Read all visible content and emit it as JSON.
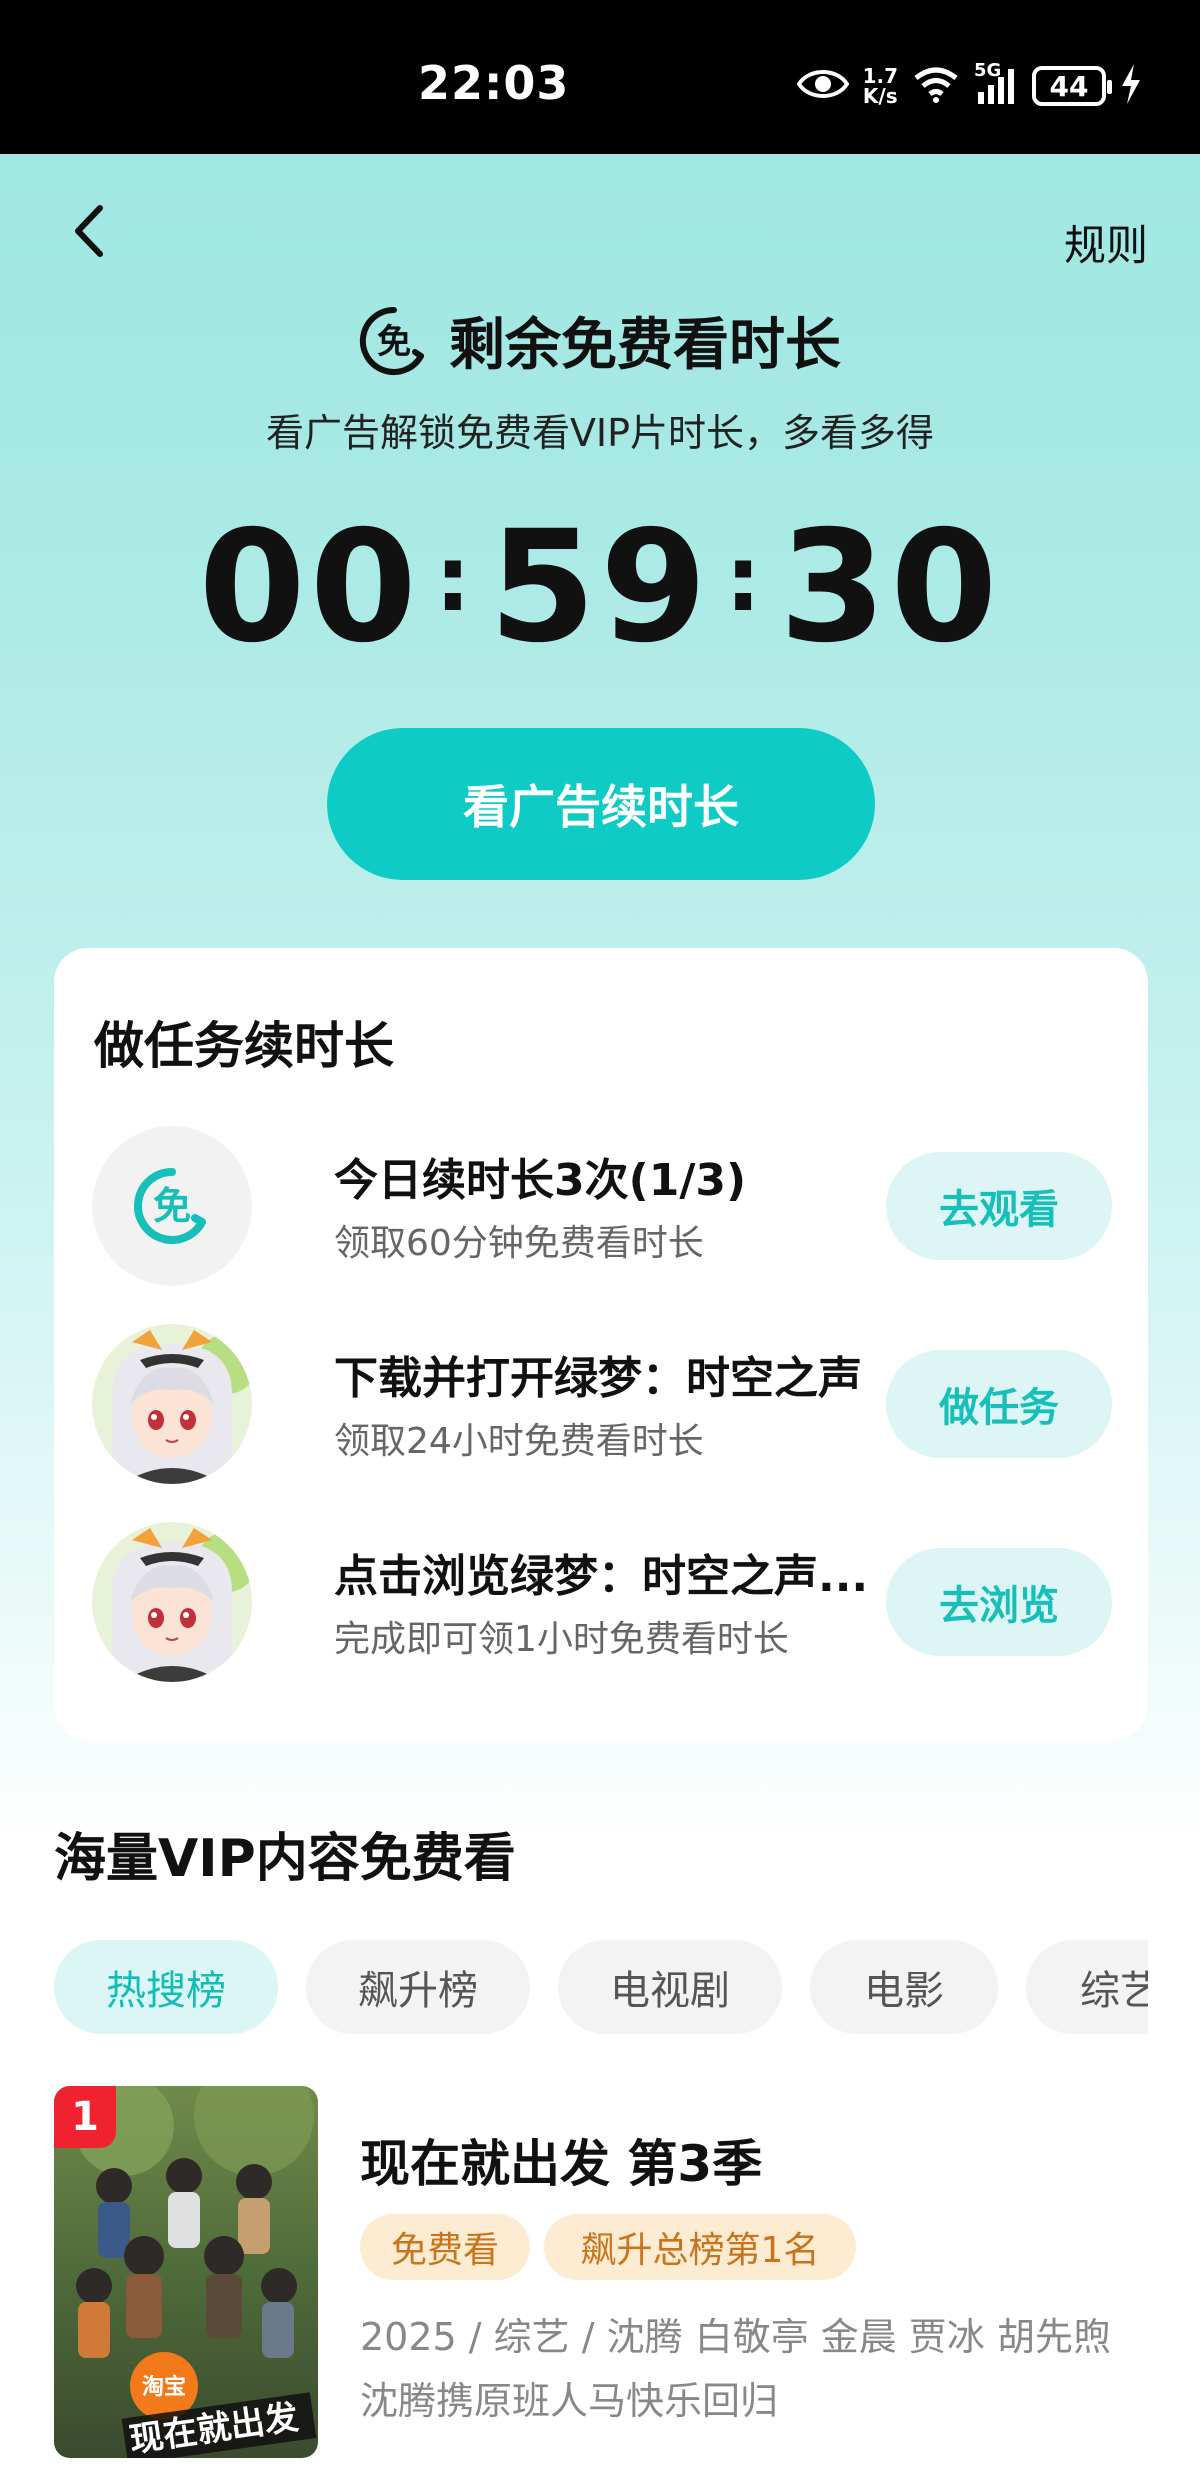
{
  "status_bar": {
    "time": "22:03",
    "net_speed_value": "1.7",
    "net_speed_unit": "K/s",
    "signal_label": "5G",
    "battery": "44"
  },
  "header": {
    "rules_label": "规则",
    "title": "剩余免费看时长",
    "subtitle": "看广告解锁免费看VIP片时长，多看多得"
  },
  "timer": {
    "hours": "00",
    "minutes": "59",
    "seconds": "30"
  },
  "cta": {
    "label": "看广告续时长"
  },
  "tasks": {
    "title": "做任务续时长",
    "items": [
      {
        "title": "今日续时长3次(1/3)",
        "desc": "领取60分钟免费看时长",
        "button": "去观看",
        "avatar": "free-badge-icon"
      },
      {
        "title": "下载并打开绿梦：时空之声",
        "desc": "领取24小时免费看时长",
        "button": "做任务",
        "avatar": "anime-girl-avatar"
      },
      {
        "title": "点击浏览绿梦：时空之声...",
        "desc": "完成即可领1小时免费看时长",
        "button": "去浏览",
        "avatar": "anime-girl-avatar"
      }
    ]
  },
  "vip_section": {
    "title": "海量VIP内容免费看",
    "tabs": [
      "热搜榜",
      "飙升榜",
      "电视剧",
      "电影",
      "综艺"
    ]
  },
  "list_item": {
    "rank": "1",
    "title": "现在就出发 第3季",
    "tags": [
      "免费看",
      "飙升总榜第1名"
    ],
    "meta": "2025 / 综艺 / 沈腾 白敬亭 金晨 贾冰 胡先煦",
    "desc": "沈腾携原班人马快乐回归",
    "poster_logo": "淘宝",
    "poster_caption": "现在就出发"
  },
  "colors": {
    "accent": "#0fcbc6",
    "accent_light": "#ddf6f5",
    "tag_bg": "#fdebd2",
    "tag_text": "#c9741a",
    "rank_red": "#f0222f"
  }
}
